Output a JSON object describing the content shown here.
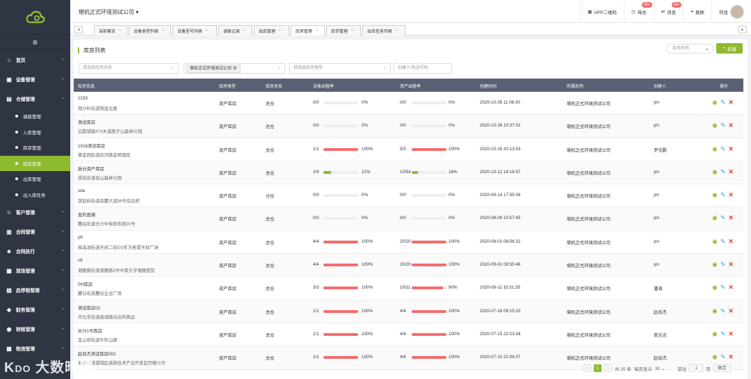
{
  "header": {
    "company": "堪机正式环境测试公司",
    "app_qr": "APP二维码",
    "todo": "待办",
    "todo_badge": "99+",
    "msg": "消息",
    "msg_badge": "99+",
    "skin": "换肤",
    "user": "何龙"
  },
  "sidebar": {
    "items": [
      {
        "label": "首页",
        "icon": "home-icon"
      },
      {
        "label": "设备管理",
        "icon": "device-icon"
      },
      {
        "label": "仓储管理",
        "icon": "warehouse-icon"
      },
      {
        "label": "调拨管理"
      },
      {
        "label": "入库管理"
      },
      {
        "label": "库存管理"
      },
      {
        "label": "库房管理"
      },
      {
        "label": "出库管理"
      },
      {
        "label": "出入库任务"
      },
      {
        "label": "客户管理",
        "icon": "user-icon"
      },
      {
        "label": "合同管理",
        "icon": "contract-icon"
      },
      {
        "label": "合同执行",
        "icon": "execute-icon"
      },
      {
        "label": "现场管理",
        "icon": "site-icon"
      },
      {
        "label": "启停租管理",
        "icon": "rent-icon"
      },
      {
        "label": "财务管理",
        "icon": "finance-icon"
      },
      {
        "label": "转租管理",
        "icon": "sublease-icon"
      },
      {
        "label": "物流管理",
        "icon": "truck-icon"
      }
    ]
  },
  "tabs": [
    "当前概览",
    "设备类型列表",
    "设备型号列表",
    "调拨记录",
    "出库管理",
    "库房管理",
    "库存管理",
    "出库任务列表"
  ],
  "panel": {
    "title": "库房列表",
    "search_placeholder": "库房名称",
    "new_label": "新建"
  },
  "filters": {
    "relation_placeholder": "请选择库房关系",
    "company_tag": "堪机正式环境测试公司",
    "type_placeholder": "请选择库房类型",
    "contact_placeholder": "创建人/电话号码"
  },
  "columns": [
    "库房信息",
    "库房类型",
    "库房关系",
    "设备出租率",
    "资产出租率",
    "创建时间",
    "所属机构",
    "创建人",
    "操作"
  ],
  "rows": [
    {
      "name": "1233",
      "addr": "观沙岭街道银盆北路",
      "type": "资产库房",
      "rel": "总仓",
      "d": "0/0",
      "dp": "0%",
      "dv": 0,
      "a": "0/0",
      "ap": "0%",
      "av": 0,
      "time": "2020-10-26 11:08:30",
      "org": "堪机正式环境测试公司",
      "creator": "yin"
    },
    {
      "name": "测试库房",
      "addr": "白箬铺镇473乡道跑子山森林公园",
      "type": "资产库房",
      "rel": "总仓",
      "d": "0/0",
      "dp": "0%",
      "dv": 0,
      "a": "0/0",
      "ap": "0%",
      "av": 0,
      "time": "2020-10-26 10:37:02",
      "org": "堪机正式环境测试公司",
      "creator": "yin"
    },
    {
      "name": "1016测试库房",
      "addr": "黄金园街道迎河路金桥国际",
      "type": "资产库房",
      "rel": "总仓",
      "d": "1/1",
      "dp": "100%",
      "dv": 100,
      "a": "5/5",
      "ap": "100%",
      "av": 100,
      "time": "2020-10-16 20:13:53",
      "org": "堪机正式环境测试公司",
      "creator": "尹浩鹏"
    },
    {
      "name": "拆分资产库房",
      "addr": "望岳街道岳山森林公园",
      "type": "资产库房",
      "rel": "总仓",
      "d": "2/9",
      "dp": "22%",
      "dv": 22,
      "a": "10/54",
      "ap": "18%",
      "av": 18,
      "time": "2020-10-12 14:16:57",
      "org": "堪机正式环境测试公司",
      "creator": "yin"
    },
    {
      "name": "sda",
      "addr": "银盆岭街道岳麓大道56号岳北桥",
      "type": "资产库房",
      "rel": "分仓",
      "d": "0/0",
      "dp": "0%",
      "dv": 0,
      "a": "0/0",
      "ap": "0%",
      "av": 0,
      "time": "2020-09-14 17:55:08",
      "org": "堪机正式环境测试公司",
      "creator": "yin"
    },
    {
      "name": "发的恩佛",
      "addr": "麓谷街道长沙中电软件园20号",
      "type": "资产库房",
      "rel": "总仓",
      "d": "0/0",
      "dp": "0%",
      "dv": 0,
      "a": "0/0",
      "ap": "0%",
      "av": 0,
      "time": "2020-09-09 10:57:45",
      "org": "堪机正式环境测试公司",
      "creator": "yin"
    },
    {
      "name": "ptt",
      "addr": "梅溪湖街道天府二街DS东方希望天祥广场",
      "type": "资产库房",
      "rel": "总仓",
      "d": "4/4",
      "dp": "100%",
      "dv": 100,
      "a": "20/20",
      "ap": "100%",
      "av": 100,
      "time": "2020-09-01 08:56:32",
      "org": "堪机正式环境测试公司",
      "creator": "yin"
    },
    {
      "name": "ctt",
      "addr": "湘雅路街道湘雅路3号中南大学湘雅医院",
      "type": "资产库房",
      "rel": "总仓",
      "d": "4/4",
      "dp": "100%",
      "dv": 100,
      "a": "20/20",
      "ap": "100%",
      "av": 100,
      "time": "2020-09-01 08:55:46",
      "org": "堪机正式环境测试公司",
      "creator": "yin"
    },
    {
      "name": "PH库房",
      "addr": "麓谷街道麓谷企业广场",
      "type": "资产库房",
      "rel": "总仓",
      "d": "3/3",
      "dp": "100%",
      "dv": 100,
      "a": "10/11",
      "ap": "90%",
      "av": 90,
      "time": "2020-08-11 15:31:35",
      "org": "堪机正式环境测试公司",
      "creator": "潘海"
    },
    {
      "name": "测试库房02",
      "addr": "开元东街道县城路派出所周边",
      "type": "资产库房",
      "rel": "总仓",
      "d": "1/1",
      "dp": "100%",
      "dv": 100,
      "a": "4/4",
      "ap": "100%",
      "av": 100,
      "time": "2020-07-16 09:15:20",
      "org": "堪机正式环境测试公司",
      "creator": "赵尚杰"
    },
    {
      "name": "长沙1号库房",
      "addr": "金山桥街道牛形山路",
      "type": "资产库房",
      "rel": "总仓",
      "d": "1/1",
      "dp": "100%",
      "dv": 100,
      "a": "4/4",
      "ap": "100%",
      "av": 100,
      "time": "2020-07-15 22:23:34",
      "org": "堪机正式环境测试公司",
      "creator": "贾吉吉"
    },
    {
      "name": "赵尚杰测试库房002",
      "addr": "湘龙街道望城区高新技术产业开发区同德公司",
      "type": "资产库房",
      "rel": "总仓",
      "d": "1/1",
      "dp": "100%",
      "dv": 100,
      "a": "4/4",
      "ap": "100%",
      "av": 100,
      "time": "2020-07-15 22:06:07",
      "org": "堪机正式环境测试公司",
      "creator": "赵尚杰"
    }
  ],
  "pager": {
    "current": "1",
    "total": "共 25 条",
    "per_page": "每页显示",
    "size": "30",
    "goto": "前往",
    "page_input": "1",
    "page_unit": "页",
    "confirm": "确定"
  },
  "watermark": "大数暗猿",
  "colors": {
    "accent": "#8fba2f",
    "bar_red": "#f56c6c",
    "bar_green": "#8fba2f",
    "sidebar": "#2f3542"
  }
}
